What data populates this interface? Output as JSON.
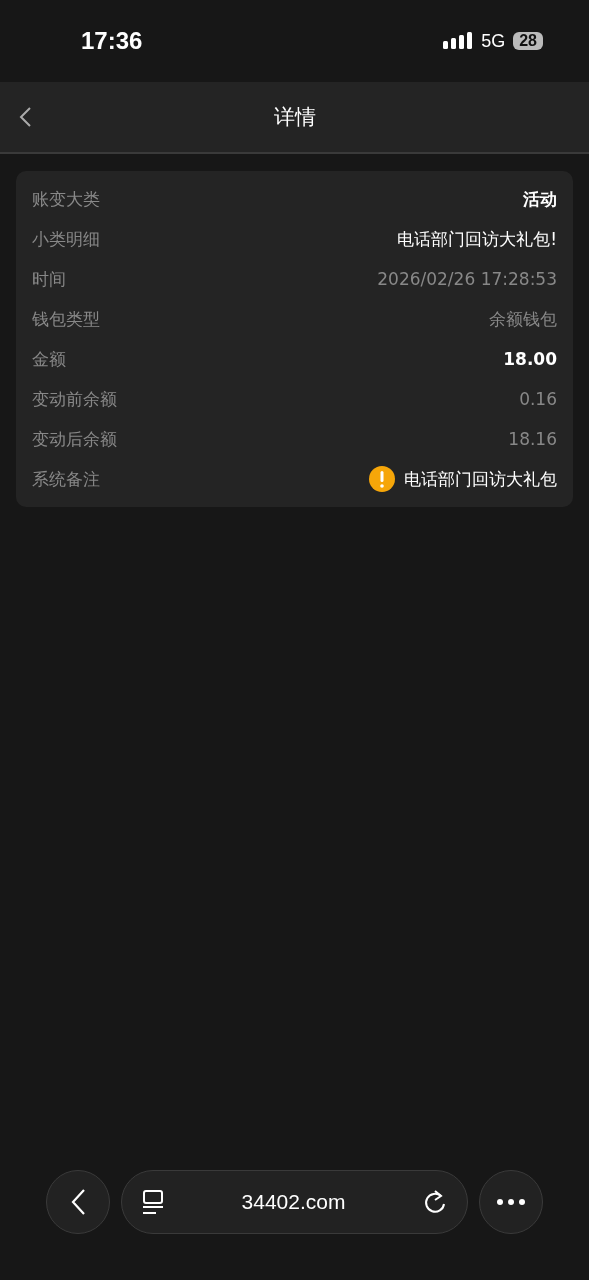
{
  "status_bar": {
    "time": "17:36",
    "network": "5G",
    "battery": "28"
  },
  "nav": {
    "title": "详情"
  },
  "rows": [
    {
      "label": "账变大类",
      "value": "活动",
      "kind": "bold"
    },
    {
      "label": "小类明细",
      "value": "电话部门回访大礼包!",
      "kind": "plain"
    },
    {
      "label": "时间",
      "value": "2026/02/26 17:28:53",
      "kind": "muted"
    },
    {
      "label": "钱包类型",
      "value": "余额钱包",
      "kind": "muted"
    },
    {
      "label": "金额",
      "value": "18.00",
      "kind": "bold"
    },
    {
      "label": "变动前余额",
      "value": "0.16",
      "kind": "muted"
    },
    {
      "label": "变动后余额",
      "value": "18.16",
      "kind": "muted"
    },
    {
      "label": "系统备注",
      "value": "电话部门回访大礼包",
      "kind": "note"
    }
  ],
  "browser": {
    "url": "34402.com"
  }
}
